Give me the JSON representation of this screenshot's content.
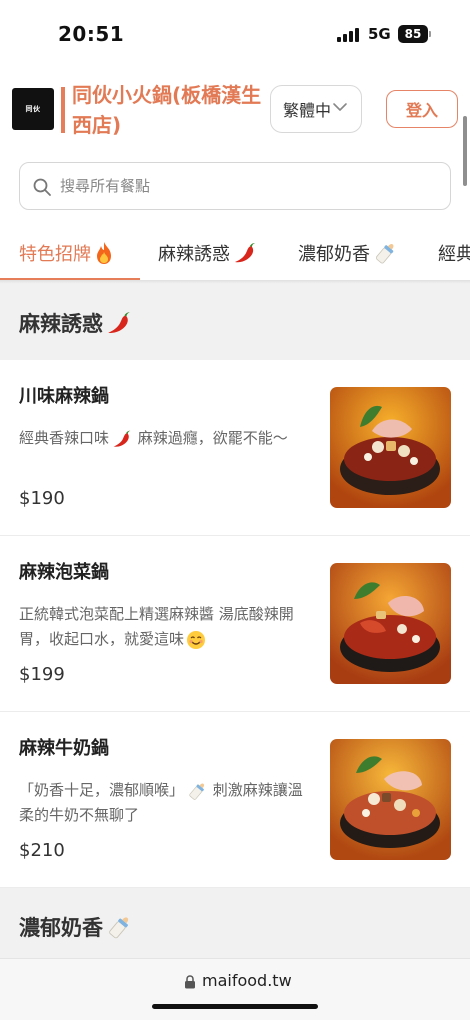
{
  "status_bar": {
    "time": "20:51",
    "network": "5G",
    "battery": "85"
  },
  "header": {
    "logo_text": "同伙 ",
    "title": "同伙小火鍋(板橋漢生西店)",
    "language_label": "繁體中",
    "login_label": "登入",
    "accent_color": "#e27a55"
  },
  "search": {
    "placeholder": "搜尋所有餐點"
  },
  "tabs": [
    {
      "label": "特色招牌",
      "icon": "fire-icon",
      "active": true
    },
    {
      "label": "麻辣誘惑",
      "icon": "chili-pepper-icon",
      "active": false
    },
    {
      "label": "濃郁奶香",
      "icon": "baby-bottle-icon",
      "active": false
    },
    {
      "label": "經典",
      "icon": "",
      "active": false
    }
  ],
  "sections": [
    {
      "title": "麻辣誘惑",
      "icon": "chili-pepper-icon"
    },
    {
      "title": "濃郁奶香",
      "icon": "baby-bottle-icon"
    }
  ],
  "items": [
    {
      "name": "川味麻辣鍋",
      "desc_a": "經典香辣口味",
      "desc_b": " 麻辣過癮，欲罷不能～",
      "price": "$190"
    },
    {
      "name": "麻辣泡菜鍋",
      "desc_a": "正統韓式泡菜配上精選麻辣醬 湯底酸辣開胃，收起口水，就愛這味",
      "desc_b": "",
      "price": "$199"
    },
    {
      "name": "麻辣牛奶鍋",
      "desc_a": "「奶香十足，濃郁順喉」",
      "desc_b": " 刺激麻辣讓溫柔的牛奶不無聊了",
      "price": "$210"
    }
  ],
  "browser": {
    "url": "maifood.tw"
  }
}
